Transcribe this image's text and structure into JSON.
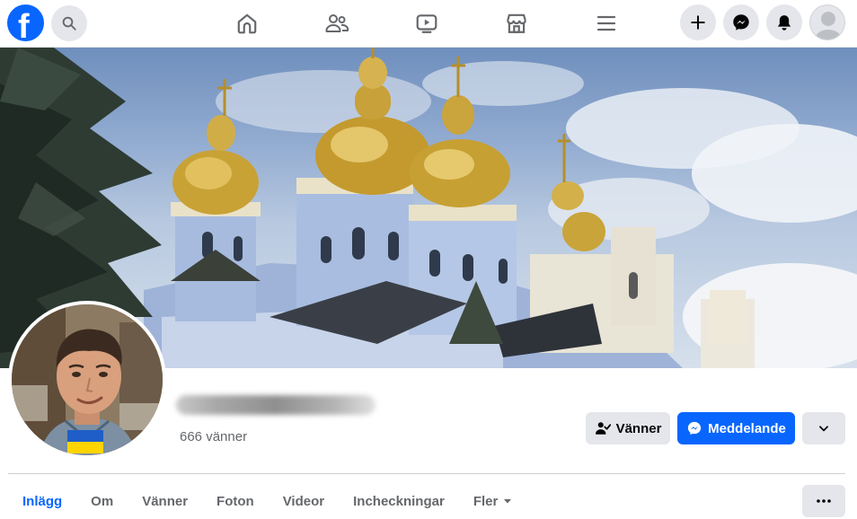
{
  "nav": {
    "logo_icon": "facebook-logo-icon",
    "search_icon": "search-icon",
    "center_icons": [
      "home-icon",
      "friends-icon",
      "watch-video-icon",
      "marketplace-icon",
      "menu-hamburger-icon"
    ],
    "right_icons": [
      "plus-icon",
      "messenger-icon",
      "notifications-bell-icon",
      "account-avatar-icon"
    ]
  },
  "profile": {
    "friends_count": "666 vänner",
    "friends_button": "Vänner",
    "message_button": "Meddelande"
  },
  "tabs": [
    {
      "label": "Inlägg",
      "active": true
    },
    {
      "label": "Om"
    },
    {
      "label": "Vänner"
    },
    {
      "label": "Foton"
    },
    {
      "label": "Videor"
    },
    {
      "label": "Incheckningar"
    },
    {
      "label": "Fler"
    }
  ],
  "colors": {
    "brand": "#0866ff",
    "button_gray": "#e4e6eb",
    "secondary_text": "#65676b"
  }
}
